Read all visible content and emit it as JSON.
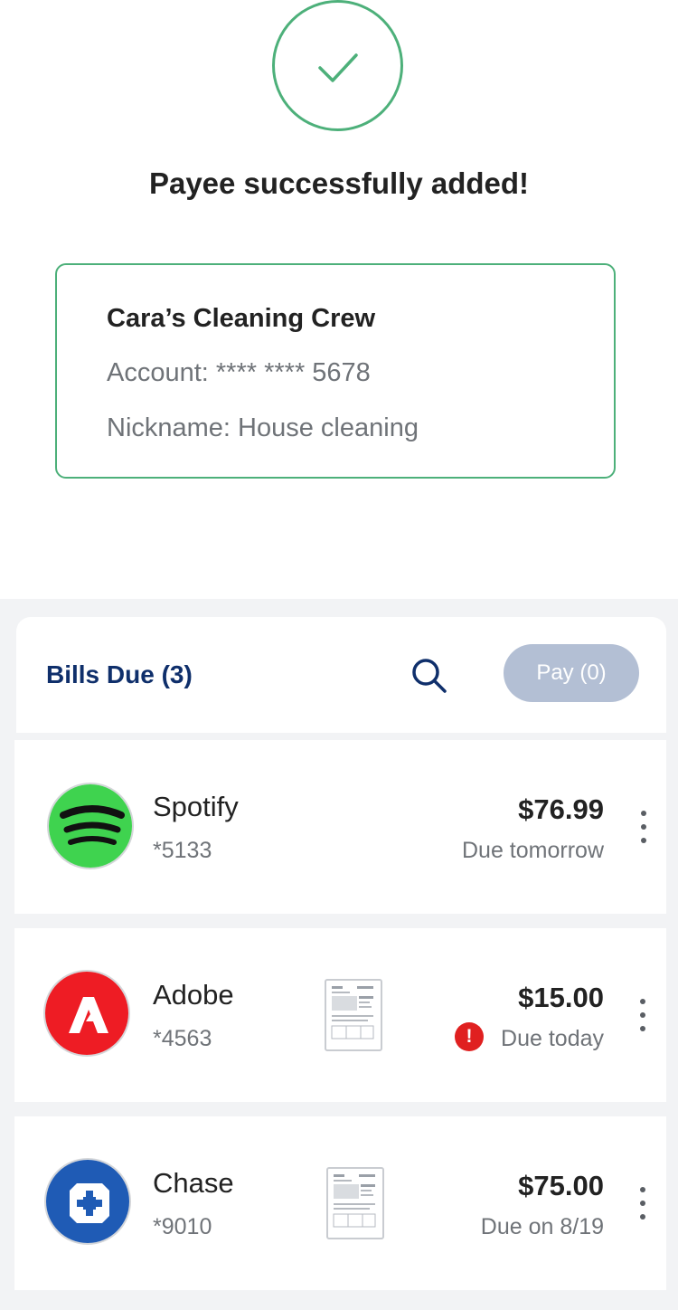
{
  "success": {
    "title": "Payee successfully added!",
    "accent_color": "#4db07a",
    "icon": "check-icon"
  },
  "payee": {
    "name": "Cara’s Cleaning Crew",
    "account": "Account: **** **** 5678",
    "nickname": "Nickname: House cleaning"
  },
  "bills": {
    "title": "Bills Due (3)",
    "search_icon": "search-icon",
    "pay_label": "Pay (0)",
    "items": [
      {
        "name": "Spotify",
        "account": "*5133",
        "amount": "$76.99",
        "due": "Due tomorrow",
        "logo_icon": "spotify-logo",
        "logo_color": "#3fd34f",
        "has_document": false,
        "alert": false
      },
      {
        "name": "Adobe",
        "account": "*4563",
        "amount": "$15.00",
        "due": "Due today",
        "logo_icon": "adobe-logo",
        "logo_color": "#ee1c24",
        "has_document": true,
        "alert": true,
        "alert_symbol": "!"
      },
      {
        "name": "Chase",
        "account": "*9010",
        "amount": "$75.00",
        "due": "Due on 8/19",
        "logo_icon": "chase-logo",
        "logo_color": "#1f5bb5",
        "has_document": true,
        "alert": false
      }
    ]
  }
}
